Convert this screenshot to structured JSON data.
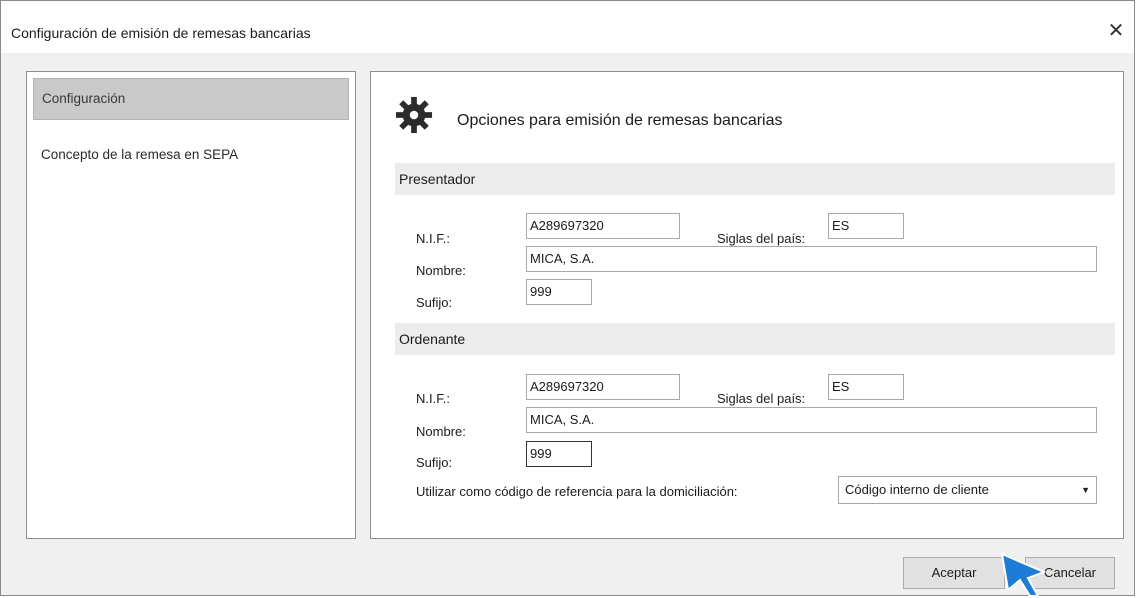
{
  "window": {
    "title": "Configuración de emisión de remesas bancarias",
    "close_glyph": "✕"
  },
  "sidebar": {
    "items": [
      {
        "label": "Configuración",
        "selected": true
      },
      {
        "label": "Concepto de la remesa en SEPA",
        "selected": false
      }
    ]
  },
  "main": {
    "header_icon": "gear-icon",
    "header_text": "Opciones para emisión de remesas bancarias",
    "presentador": {
      "section_title": "Presentador",
      "nif_label": "N.I.F.:",
      "nif_value": "A289697320",
      "pais_label": "Siglas del país:",
      "pais_value": "ES",
      "nombre_label": "Nombre:",
      "nombre_value": "MICA, S.A.",
      "sufijo_label": "Sufijo:",
      "sufijo_value": "999"
    },
    "ordenante": {
      "section_title": "Ordenante",
      "nif_label": "N.I.F.:",
      "nif_value": "A289697320",
      "pais_label": "Siglas del país:",
      "pais_value": "ES",
      "nombre_label": "Nombre:",
      "nombre_value": "MICA, S.A.",
      "sufijo_label": "Sufijo:",
      "sufijo_value": "999"
    },
    "referencia_label": "Utilizar como código de referencia para la domiciliación:",
    "referencia_selected": "Código interno de cliente"
  },
  "footer": {
    "accept_label": "Aceptar",
    "cancel_label": "Cancelar"
  },
  "colors": {
    "pointer": "#1e7bd6",
    "section_bg": "#ececec",
    "selected_nav_bg": "#c9c9c9"
  }
}
